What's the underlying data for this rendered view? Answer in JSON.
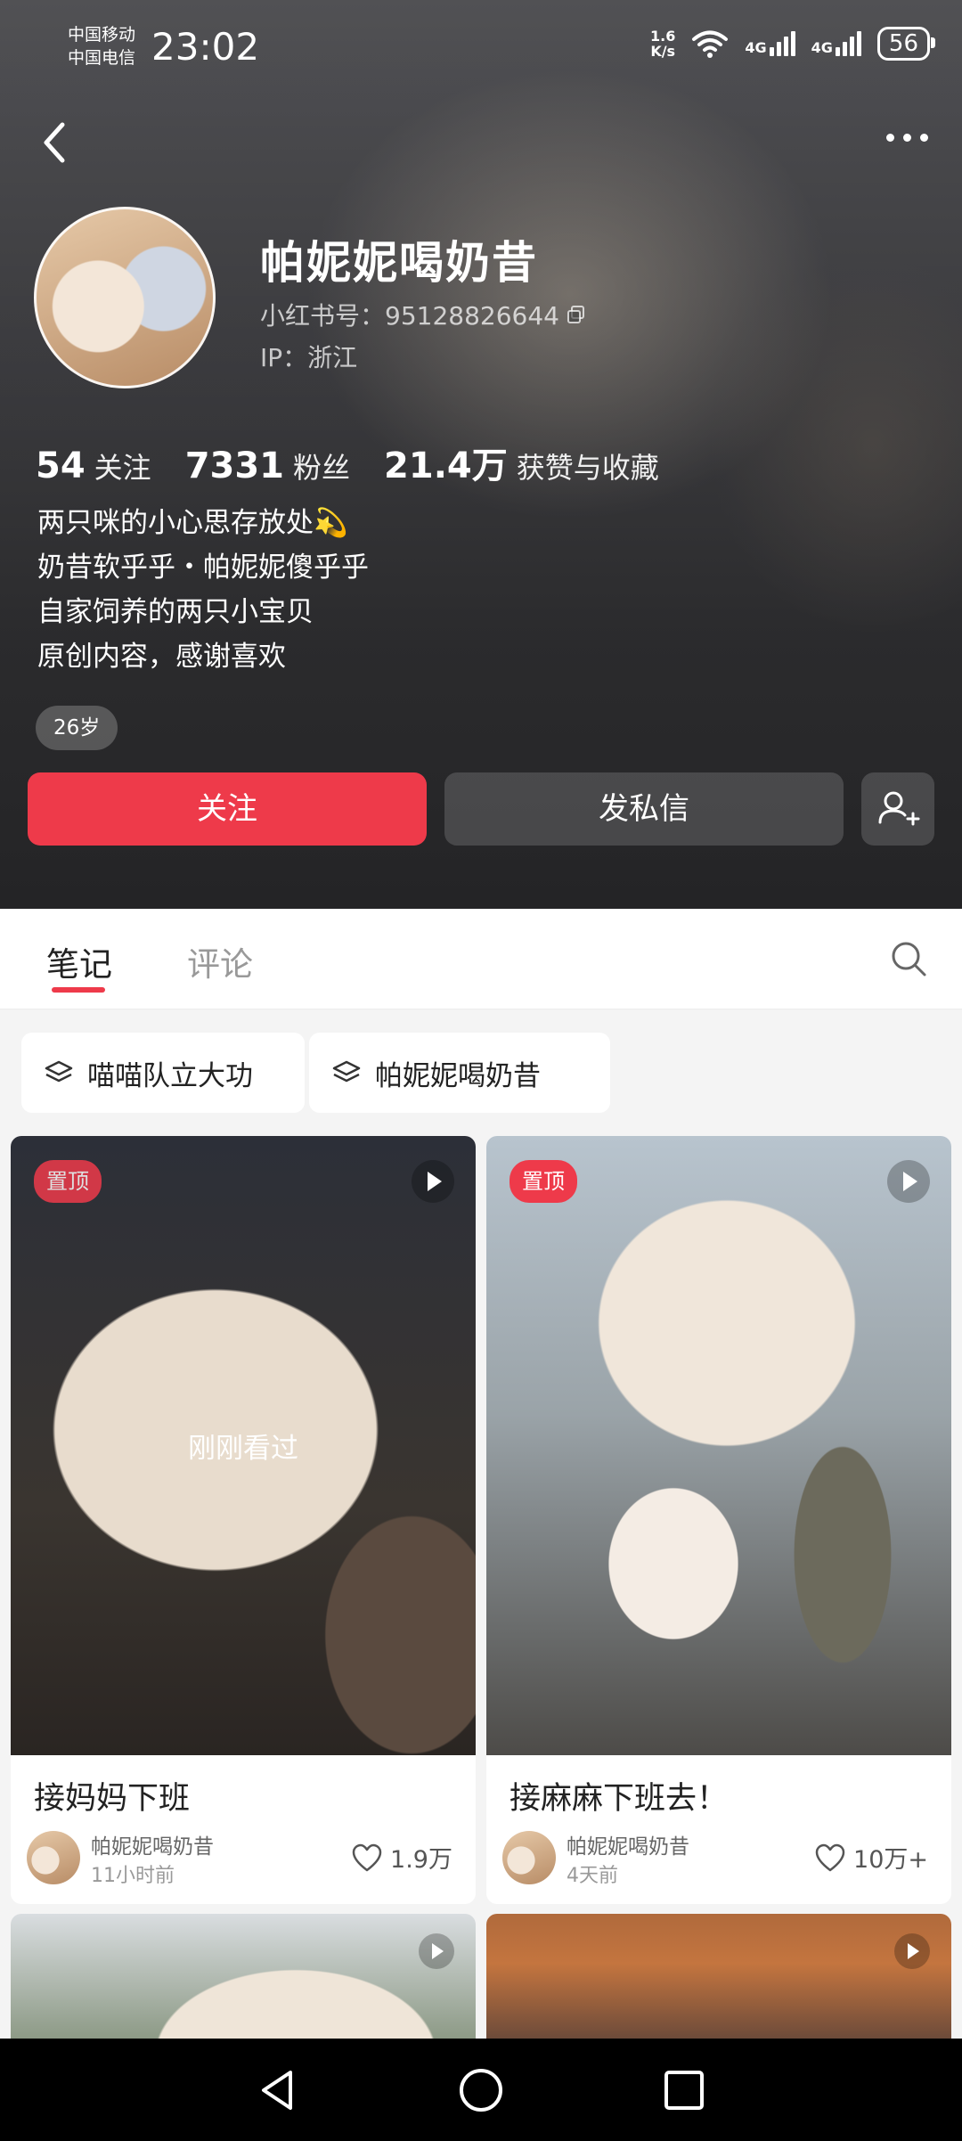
{
  "status_bar": {
    "carrier1": "中国移动",
    "carrier2": "中国电信",
    "time": "23:02",
    "net_speed_value": "1.6",
    "net_speed_unit": "K/s",
    "signal1": "4G",
    "signal2": "4G",
    "battery": "56"
  },
  "profile": {
    "name": "帕妮妮喝奶昔",
    "id_text": "小红书号：95128826644",
    "ip_text": "IP：浙江",
    "stats": [
      {
        "num": "54",
        "label": "关注"
      },
      {
        "num": "7331",
        "label": "粉丝"
      },
      {
        "num": "21.4万",
        "label": "获赞与收藏"
      }
    ],
    "bio": [
      "两只咪的小心思存放处💫",
      "奶昔软乎乎・帕妮妮傻乎乎",
      "自家饲养的两只小宝贝",
      "原创内容，感谢喜欢"
    ],
    "age_tag": "26岁"
  },
  "actions": {
    "follow": "关注",
    "message": "发私信"
  },
  "tabs": {
    "notes": "笔记",
    "comments": "评论"
  },
  "collections": [
    "喵喵队立大功",
    "帕妮妮喝奶昔"
  ],
  "notes": [
    {
      "pin": "置顶",
      "overlay": "刚刚看过",
      "title": "接妈妈下班",
      "author": "帕妮妮喝奶昔",
      "time": "11小时前",
      "likes": "1.9万"
    },
    {
      "pin": "置顶",
      "overlay": "",
      "title": "接麻麻下班去！",
      "author": "帕妮妮喝奶昔",
      "time": "4天前",
      "likes": "10万+"
    }
  ],
  "colors": {
    "accent": "#ee3a4a"
  }
}
